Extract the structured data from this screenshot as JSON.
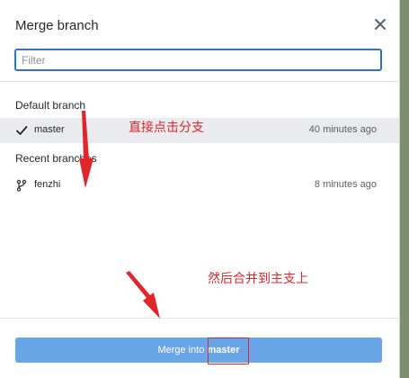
{
  "dialog": {
    "title": "Merge branch",
    "close_icon": "close-icon",
    "filter_placeholder": "Filter"
  },
  "sections": {
    "default_label": "Default branch",
    "recent_label": "Recent branches"
  },
  "branches": {
    "default": {
      "name": "master",
      "time": "40 minutes ago",
      "icon": "check-icon"
    },
    "recent": [
      {
        "name": "fenzhi",
        "time": "8 minutes ago",
        "icon": "branch-icon"
      }
    ]
  },
  "merge_button": {
    "prefix": "Merge into ",
    "target": "master"
  },
  "annotations": {
    "note_1": "直接点击分支",
    "note_2": "然后合并到主支上"
  },
  "colors": {
    "accent": "#2c74c8",
    "button": "#6aa5e8",
    "annotation": "#e0252b",
    "selected_row": "#e9ebee"
  }
}
